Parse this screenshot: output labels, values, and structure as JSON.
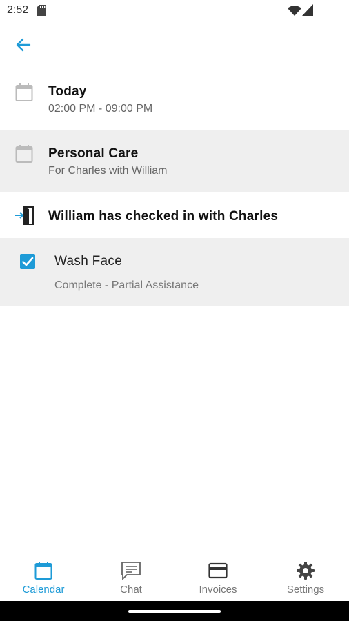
{
  "status_bar": {
    "time": "2:52"
  },
  "header": {
    "back_icon": "arrow-left-icon"
  },
  "schedule": {
    "icon": "calendar-icon",
    "title": "Today",
    "time_range": "02:00 PM - 09:00 PM"
  },
  "visit": {
    "icon": "calendar-icon",
    "title": "Personal Care",
    "subtitle": "For Charles with William"
  },
  "checkin": {
    "icon": "door-enter-icon",
    "text": "William has checked in with Charles"
  },
  "task": {
    "checked": true,
    "title": "Wash Face",
    "status": "Complete - Partial Assistance"
  },
  "bottom_nav": {
    "items": [
      {
        "label": "Calendar",
        "icon": "calendar-icon",
        "active": true
      },
      {
        "label": "Chat",
        "icon": "chat-icon",
        "active": false
      },
      {
        "label": "Invoices",
        "icon": "credit-card-icon",
        "active": false
      },
      {
        "label": "Settings",
        "icon": "gear-icon",
        "active": false
      }
    ]
  },
  "colors": {
    "accent": "#1e9bd7",
    "shaded_row": "#efefef"
  }
}
